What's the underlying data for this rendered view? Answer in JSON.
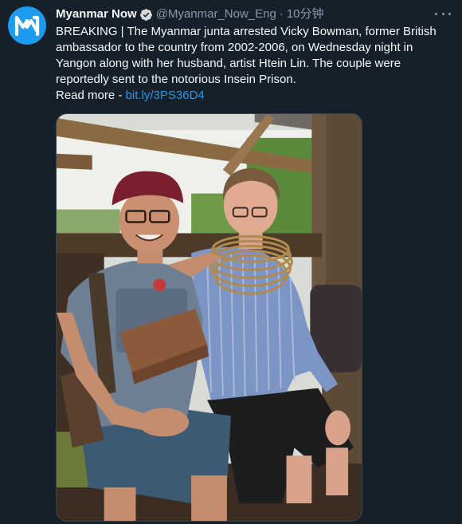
{
  "tweet": {
    "display_name": "Myanmar Now",
    "handle": "@Myanmar_Now_Eng",
    "separator": "·",
    "time": "10分钟",
    "text": "BREAKING | The Myanmar junta arrested Vicky Bowman, former British ambassador to the country from 2002-2006, on Wednesday night in Yangon along with her husband, artist Htein Lin. The couple were reportedly sent to the notorious Insein Prison.",
    "read_more_label": "Read more -",
    "link_text": "bit.ly/3PS36D4"
  },
  "icons": {
    "avatar": "myanmar-now-logo",
    "verified": "verified-badge-icon",
    "more": "more-options-icon"
  },
  "colors": {
    "background": "#15202b",
    "link": "#1d9bf0",
    "secondary_text": "#8b98a5",
    "avatar_bg": "#1d9bf0"
  }
}
